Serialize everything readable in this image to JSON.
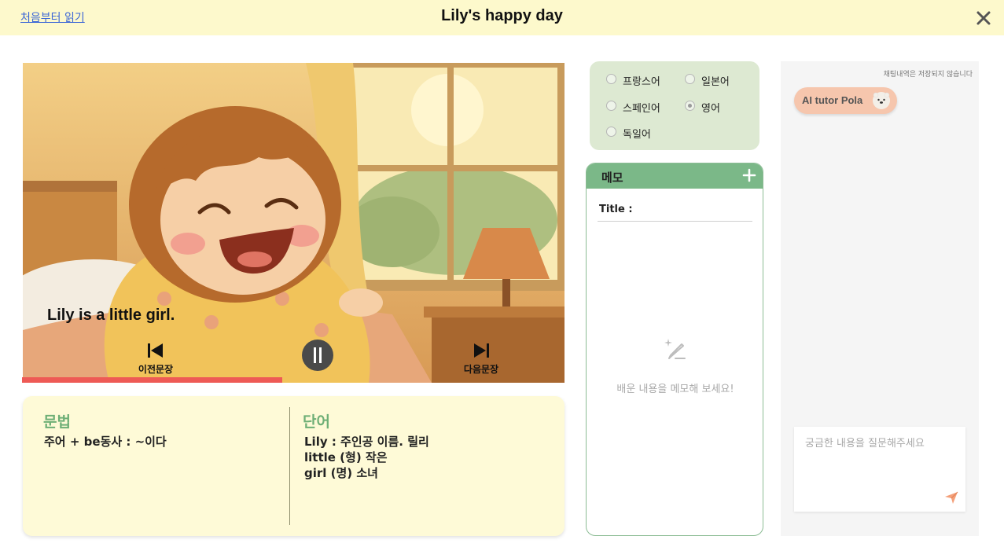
{
  "header": {
    "restart_link": "처음부터 읽기",
    "title": "Lily's happy day",
    "close_icon": "close-icon"
  },
  "player": {
    "caption": "Lily is a little girl.",
    "prev_label": "이전문장",
    "next_label": "다음문장",
    "icons": [
      "skip-previous-icon",
      "pause-icon",
      "skip-next-icon"
    ],
    "progress": 0.48,
    "progress_color": "#ee5a55"
  },
  "study": {
    "grammar_title": "문법",
    "grammar_lines": [
      "주어 + be동사 : ~이다"
    ],
    "vocab_title": "단어",
    "vocab_lines": [
      "Lily :  주인공 이름. 릴리",
      "little (형) 작은",
      "girl (명) 소녀"
    ]
  },
  "languages": {
    "options": [
      {
        "label": "프랑스어",
        "selected": false
      },
      {
        "label": "일본어",
        "selected": false
      },
      {
        "label": "스페인어",
        "selected": false
      },
      {
        "label": "영어",
        "selected": true
      },
      {
        "label": "독일어",
        "selected": false
      }
    ]
  },
  "memo": {
    "header": "메모",
    "title_label": "Title :",
    "title_value": "",
    "empty_text": "배운 내용을 메모해 보세요!",
    "add_icon": "plus-icon",
    "empty_icon": "pencil-sparkle-icon"
  },
  "chat": {
    "note": "채팅내역은 저장되지 않습니다",
    "tutor_name": "AI tutor Pola",
    "tutor_icon": "polar-bear-icon",
    "input_placeholder": "궁금한 내용을 질문해주세요",
    "input_value": "",
    "send_icon": "send-icon"
  },
  "colors": {
    "header_bg": "#fdf9cc",
    "accent_green": "#7bb888",
    "study_bg": "#fefad7",
    "tutor_badge": "#f6c6ad"
  }
}
